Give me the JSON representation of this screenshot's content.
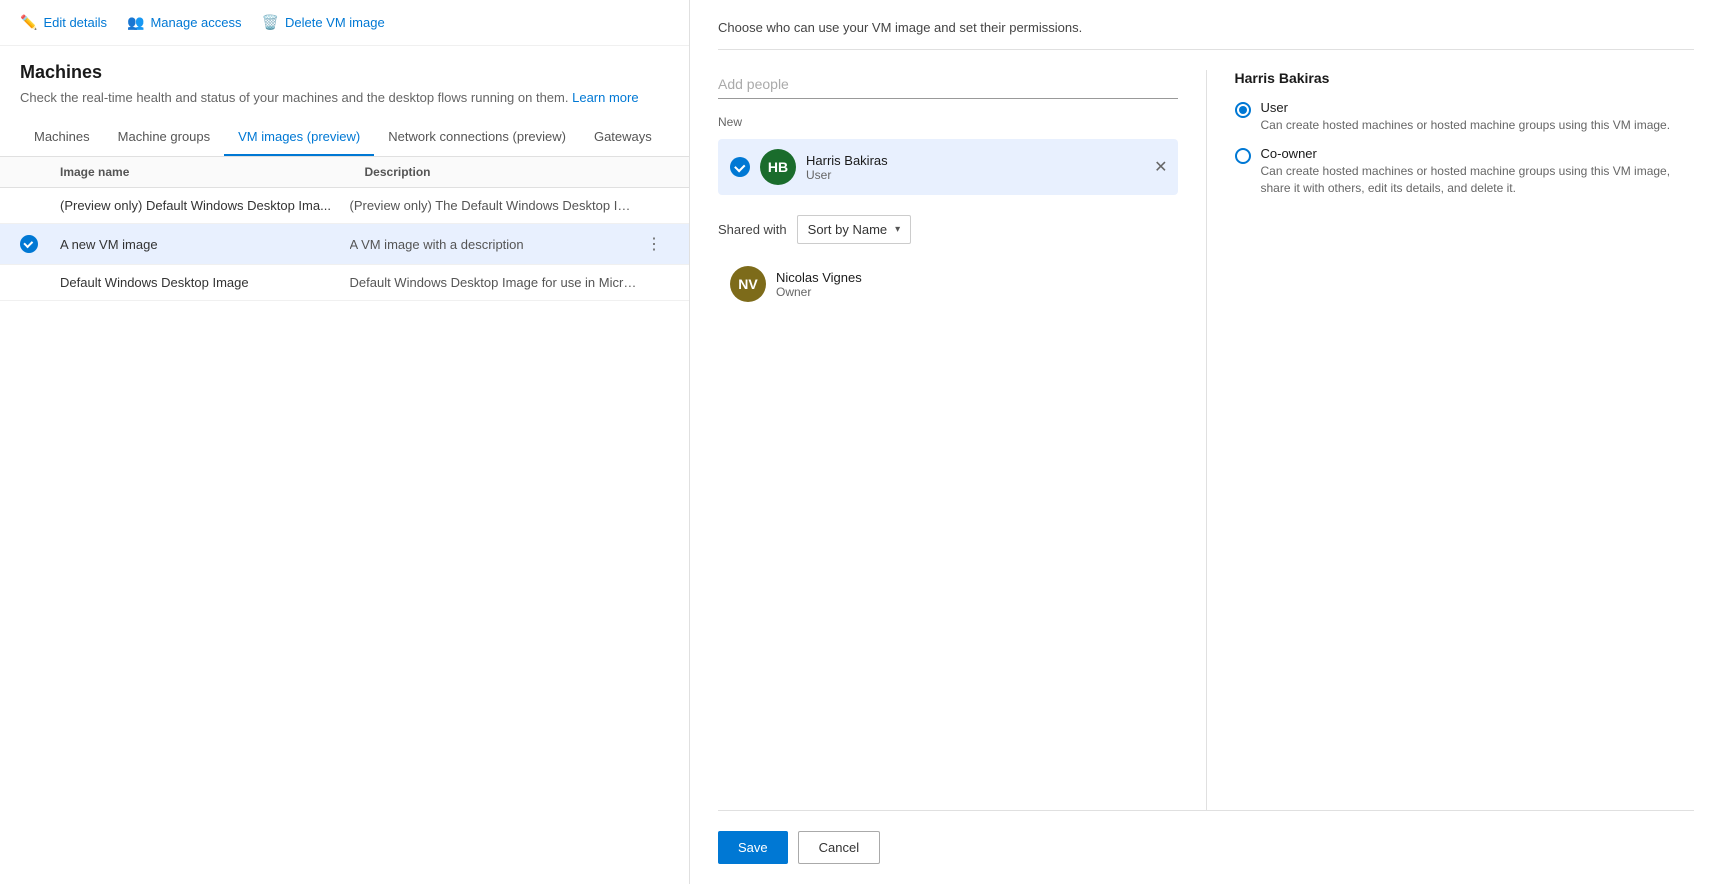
{
  "toolbar": {
    "edit_label": "Edit details",
    "manage_label": "Manage access",
    "delete_label": "Delete VM image"
  },
  "page": {
    "title": "Machines",
    "subtitle": "Check the real-time health and status of your machines and the desktop flows running on them.",
    "learn_more": "Learn more"
  },
  "tabs": [
    {
      "label": "Machines",
      "active": false
    },
    {
      "label": "Machine groups",
      "active": false
    },
    {
      "label": "VM images (preview)",
      "active": true
    },
    {
      "label": "Network connections (preview)",
      "active": false
    },
    {
      "label": "Gateways",
      "active": false
    }
  ],
  "table": {
    "col_name": "Image name",
    "col_desc": "Description",
    "rows": [
      {
        "name": "(Preview only) Default Windows Desktop Ima...",
        "description": "(Preview only) The Default Windows Desktop Image for use i...",
        "selected": false,
        "show_actions": false
      },
      {
        "name": "A new VM image",
        "description": "A VM image with a description",
        "selected": true,
        "show_actions": true
      },
      {
        "name": "Default Windows Desktop Image",
        "description": "Default Windows Desktop Image for use in Microsoft Deskto...",
        "selected": false,
        "show_actions": false
      }
    ]
  },
  "share_panel": {
    "instructions": "Choose who can use your VM image and set their permissions.",
    "add_people_placeholder": "Add people",
    "new_label": "New",
    "shared_with_label": "Shared with",
    "sort_label": "Sort by Name",
    "new_user": {
      "name": "Harris Bakiras",
      "role": "User",
      "initials": "HB"
    },
    "shared_users": [
      {
        "name": "Nicolas Vignes",
        "role": "Owner",
        "initials": "NV"
      }
    ]
  },
  "permission_panel": {
    "user_name": "Harris Bakiras",
    "options": [
      {
        "label": "User",
        "description": "Can create hosted machines or hosted machine groups using this VM image.",
        "selected": true
      },
      {
        "label": "Co-owner",
        "description": "Can create hosted machines or hosted machine groups using this VM image, share it with others, edit its details, and delete it.",
        "selected": false
      }
    ]
  },
  "footer": {
    "save_label": "Save",
    "cancel_label": "Cancel"
  }
}
